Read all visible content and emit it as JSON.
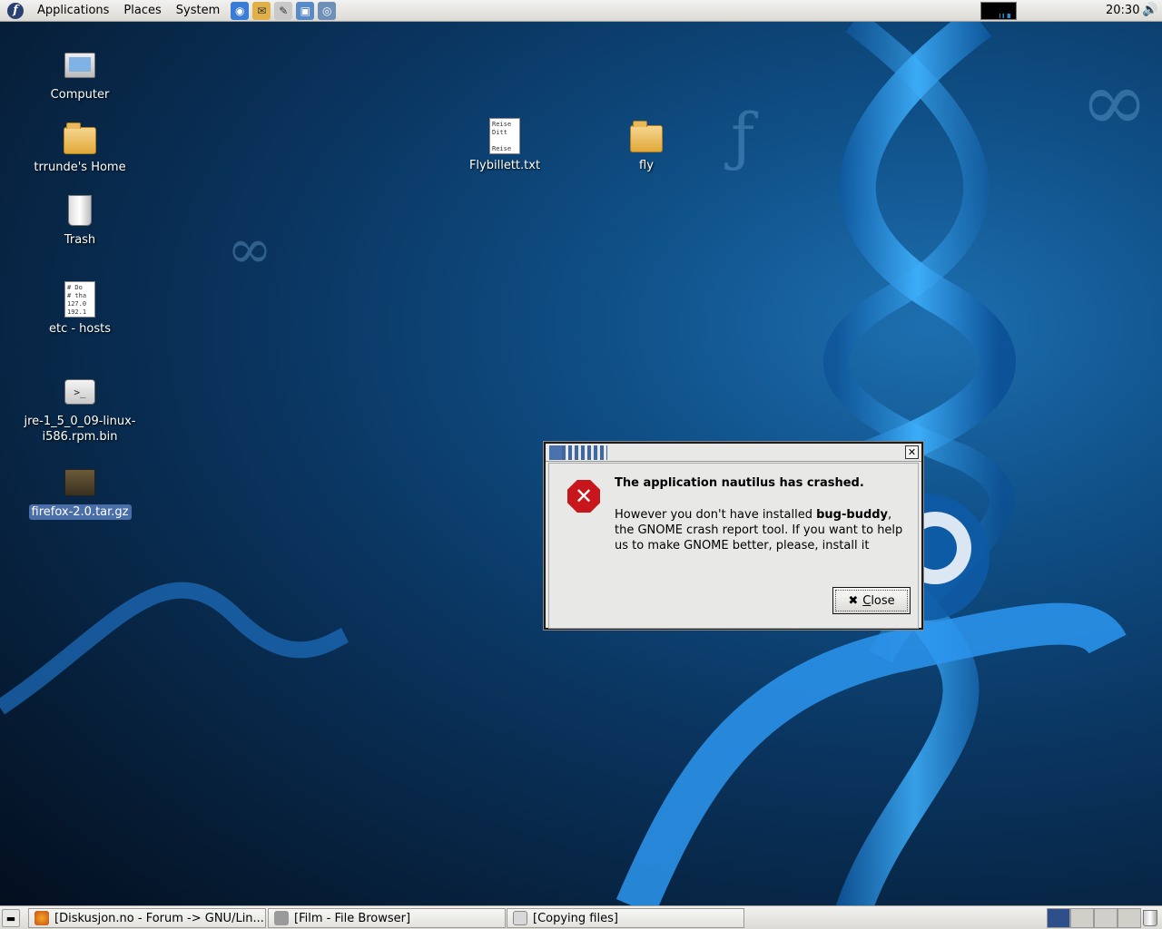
{
  "top_panel": {
    "menus": [
      "Applications",
      "Places",
      "System"
    ],
    "launchers": [
      {
        "icon": "web-browser-icon",
        "color": "#3a7bd5"
      },
      {
        "icon": "email-client-icon",
        "color": "#e0b04a"
      },
      {
        "icon": "text-editor-icon",
        "color": "#888888"
      },
      {
        "icon": "presentation-icon",
        "color": "#5a8ac6"
      },
      {
        "icon": "remote-desktop-icon",
        "color": "#6d8fb8"
      }
    ],
    "clock": "20:30"
  },
  "desktop": {
    "icons": [
      {
        "label": "Computer",
        "icon": "computer-icon"
      },
      {
        "label": "trrunde's Home",
        "icon": "home-folder-icon"
      },
      {
        "label": "Trash",
        "icon": "trash-icon"
      },
      {
        "label": "etc - hosts",
        "icon": "text-file-icon",
        "preview": "# Do\n# tha\n127.0\n192.1"
      },
      {
        "label": "jre-1_5_0_09-linux-i586.rpm.bin",
        "icon": "script-file-icon"
      },
      {
        "label": "firefox-2.0.tar.gz",
        "icon": "archive-icon",
        "selected": true
      },
      {
        "label": "Flybillett.txt",
        "icon": "text-file-icon",
        "preview": "Reise\nDitt\n\nReise"
      },
      {
        "label": "fly",
        "icon": "folder-icon"
      }
    ]
  },
  "dialog": {
    "heading": "The application nautilus has crashed.",
    "message_pre": "However you don't have installed ",
    "message_bold": "bug-buddy",
    "message_post": ", the GNOME crash report tool. If you want to help us to make GNOME better, please, install it",
    "close_label": "Close",
    "accent": "#c8161d"
  },
  "bottom_panel": {
    "tasks": [
      {
        "label": "[Diskusjon.no - Forum -> GNU/Lin...",
        "icon": "firefox-icon"
      },
      {
        "label": "[Film - File Browser]",
        "icon": "file-browser-icon"
      },
      {
        "label": "[Copying files]",
        "icon": "copy-window-icon"
      }
    ],
    "workspaces": 4,
    "active_workspace": 1
  }
}
